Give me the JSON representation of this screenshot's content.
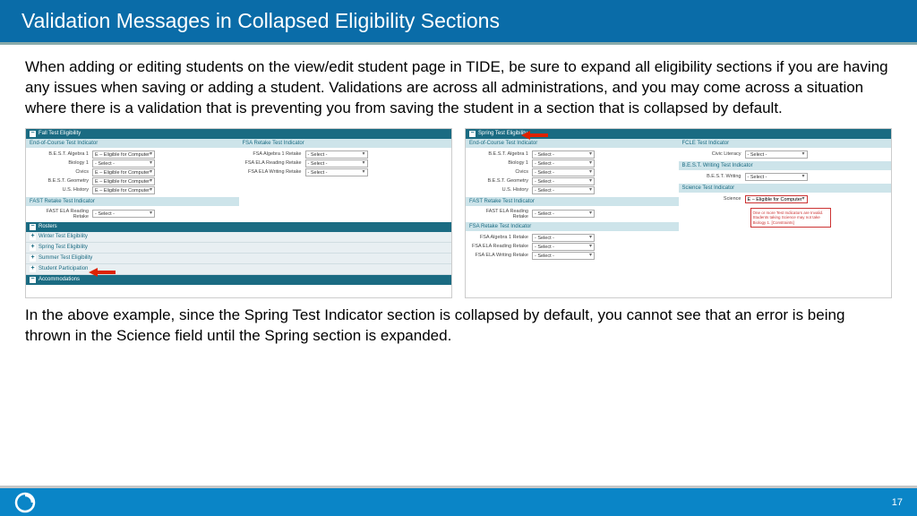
{
  "header": {
    "title": "Validation Messages in Collapsed Eligibility Sections"
  },
  "para1": "When adding or editing students on the view/edit student page in TIDE, be sure to expand all eligibility sections if you are having any issues when saving or adding a student. Validations are across all administrations, and you may come across a situation where there is a validation that is preventing you from saving the student in a section that is collapsed by default.",
  "para2": "In the above example, since the Spring Test Indicator section is collapsed by default, you cannot see that an error is being thrown in the Science field until the Spring section is expanded.",
  "left": {
    "fall_header": "Fall Test Eligibility",
    "eoc_header": "End-of-Course Test Indicator",
    "eoc_rows": [
      {
        "label": "B.E.S.T. Algebra 1",
        "value": "E – Eligible for Computer"
      },
      {
        "label": "Biology 1",
        "value": "- Select -"
      },
      {
        "label": "Civics",
        "value": "E – Eligible for Computer"
      },
      {
        "label": "B.E.S.T. Geometry",
        "value": "E – Eligible for Computer"
      },
      {
        "label": "U.S. History",
        "value": "E – Eligible for Computer"
      }
    ],
    "fsa_header": "FSA Retake Test Indicator",
    "fsa_rows": [
      {
        "label": "FSA Algebra 1 Retake",
        "value": "- Select -"
      },
      {
        "label": "FSA ELA Reading Retake",
        "value": "- Select -"
      },
      {
        "label": "FSA ELA Writing Retake",
        "value": "- Select -"
      }
    ],
    "fast_header": "FAST Retake Test Indicator",
    "fast_rows": [
      {
        "label": "FAST ELA Reading Retake",
        "value": "- Select -"
      }
    ],
    "rosters": "Rosters",
    "collapsed": [
      "Winter Test Eligibility",
      "Spring Test Eligibility",
      "Summer Test Eligibility",
      "Student Participation"
    ],
    "accom": "Accommodations"
  },
  "right": {
    "spring_header": "Spring Test Eligibility",
    "eoc_header": "End-of-Course Test Indicator",
    "eoc_rows": [
      {
        "label": "B.E.S.T. Algebra 1",
        "value": "- Select -"
      },
      {
        "label": "Biology 1",
        "value": "- Select -"
      },
      {
        "label": "Civics",
        "value": "- Select -"
      },
      {
        "label": "B.E.S.T. Geometry",
        "value": "- Select -"
      },
      {
        "label": "U.S. History",
        "value": "- Select -"
      }
    ],
    "fcle_header": "FCLE Test Indicator",
    "fcle_rows": [
      {
        "label": "Civic Literacy",
        "value": "- Select -"
      }
    ],
    "best_header": "B.E.S.T. Writing Test Indicator",
    "best_rows": [
      {
        "label": "B.E.S.T. Writing",
        "value": "- Select -"
      }
    ],
    "sci_header": "Science Test Indicator",
    "sci_rows": [
      {
        "label": "Science",
        "value": "E – Eligible for Computer"
      }
    ],
    "err_msg": "One or more Test Indicators are Invalid. Students taking Science may not take Biology 1. [Constraints]",
    "fast_header": "FAST Retake Test Indicator",
    "fast_rows": [
      {
        "label": "FAST ELA Reading Retake",
        "value": "- Select -"
      }
    ],
    "fsa_header": "FSA Retake Test Indicator",
    "fsa_rows": [
      {
        "label": "FSA Algebra 1 Retake",
        "value": "- Select -"
      },
      {
        "label": "FSA ELA Reading Retake",
        "value": "- Select -"
      },
      {
        "label": "FSA ELA Writing Retake",
        "value": "- Select -"
      }
    ]
  },
  "footer": {
    "page": "17"
  }
}
